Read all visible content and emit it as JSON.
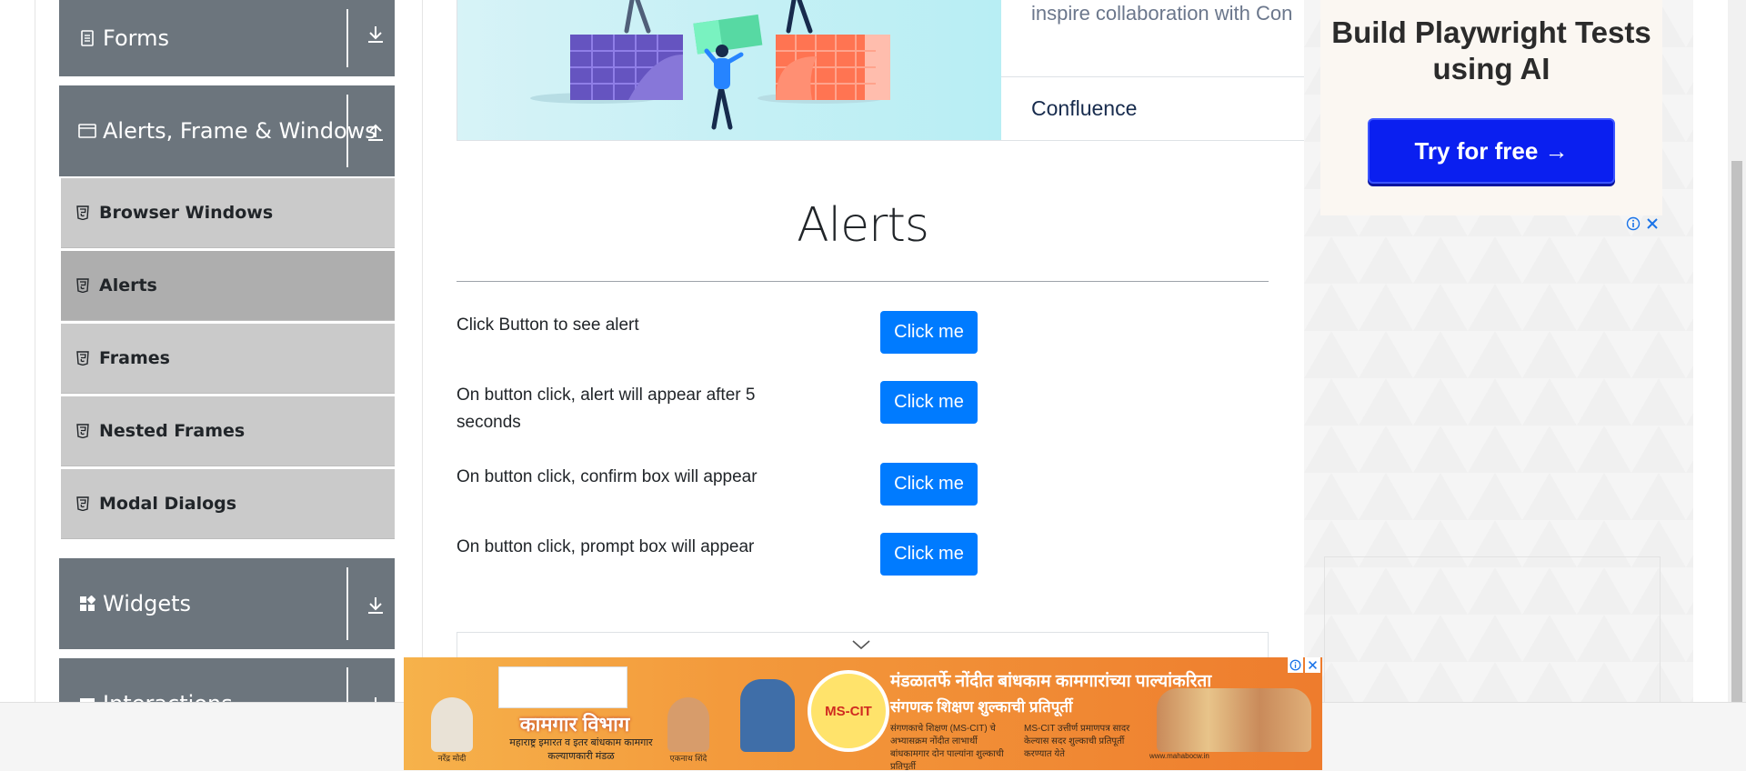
{
  "sidebar": {
    "groups": [
      {
        "label": "Forms",
        "icon": "document-icon",
        "arrow": "download-arrow-icon"
      },
      {
        "label": "Alerts, Frame & Windows",
        "icon": "window-icon",
        "arrow": "upload-arrow-icon"
      },
      {
        "label": "Widgets",
        "icon": "widgets-icon",
        "arrow": "download-arrow-icon"
      },
      {
        "label": "Interactions",
        "icon": "interactions-icon",
        "arrow": "download-arrow-icon"
      }
    ],
    "items": [
      {
        "label": "Browser Windows",
        "active": false
      },
      {
        "label": "Alerts",
        "active": true
      },
      {
        "label": "Frames",
        "active": false
      },
      {
        "label": "Nested Frames",
        "active": false
      },
      {
        "label": "Modal Dialogs",
        "active": false
      }
    ]
  },
  "banner": {
    "text": "inspire collaboration with Con",
    "link": "Confluence"
  },
  "main": {
    "title": "Alerts",
    "rows": [
      {
        "label": "Click Button to see alert",
        "button": "Click me"
      },
      {
        "label": "On button click, alert will appear after 5 seconds",
        "button": "Click me"
      },
      {
        "label": "On button click, confirm box will appear",
        "button": "Click me"
      },
      {
        "label": "On button click, prompt box will appear",
        "button": "Click me"
      }
    ]
  },
  "right_ad": {
    "headline": "Build Playwright Tests using AI",
    "cta": "Try for free →"
  },
  "bottom_ad": {
    "department": "कामगार विभाग",
    "dept_sub": "महाराष्ट्र इमारत व इतर बांधकाम कामगार कल्याणकारी मंडळ",
    "badge": "MS-CIT",
    "headline1": "मंडळातर्फे नोंदीत बांधकाम कामगारांच्या पाल्यांकरिता",
    "headline2": "संगणक शिक्षण शुल्काची प्रतिपूर्ती",
    "detail_left": "संगणकाचे शिक्षण (MS-CIT) चे अभ्यासक्रम नोंदीत लाभार्थी बांधकामगार दोन पाल्यांना शुल्काची प्रतिपूर्ती",
    "detail_right": "MS-CIT उत्तीर्ण प्रमाणपत्र सादर केल्यास सदर शुल्काची प्रतिपूर्ती करण्यात येते",
    "captions": [
      "नरेंद्र मोदी",
      "एकनाथ शिंदे"
    ],
    "footer": "www.mahabocw.in"
  },
  "colors": {
    "sidebar_group": "#6c757d",
    "sidebar_item": "#cacaca",
    "sidebar_active": "#aeaeae",
    "primary_button": "#007bff",
    "cta_button": "#0a1ff0"
  }
}
